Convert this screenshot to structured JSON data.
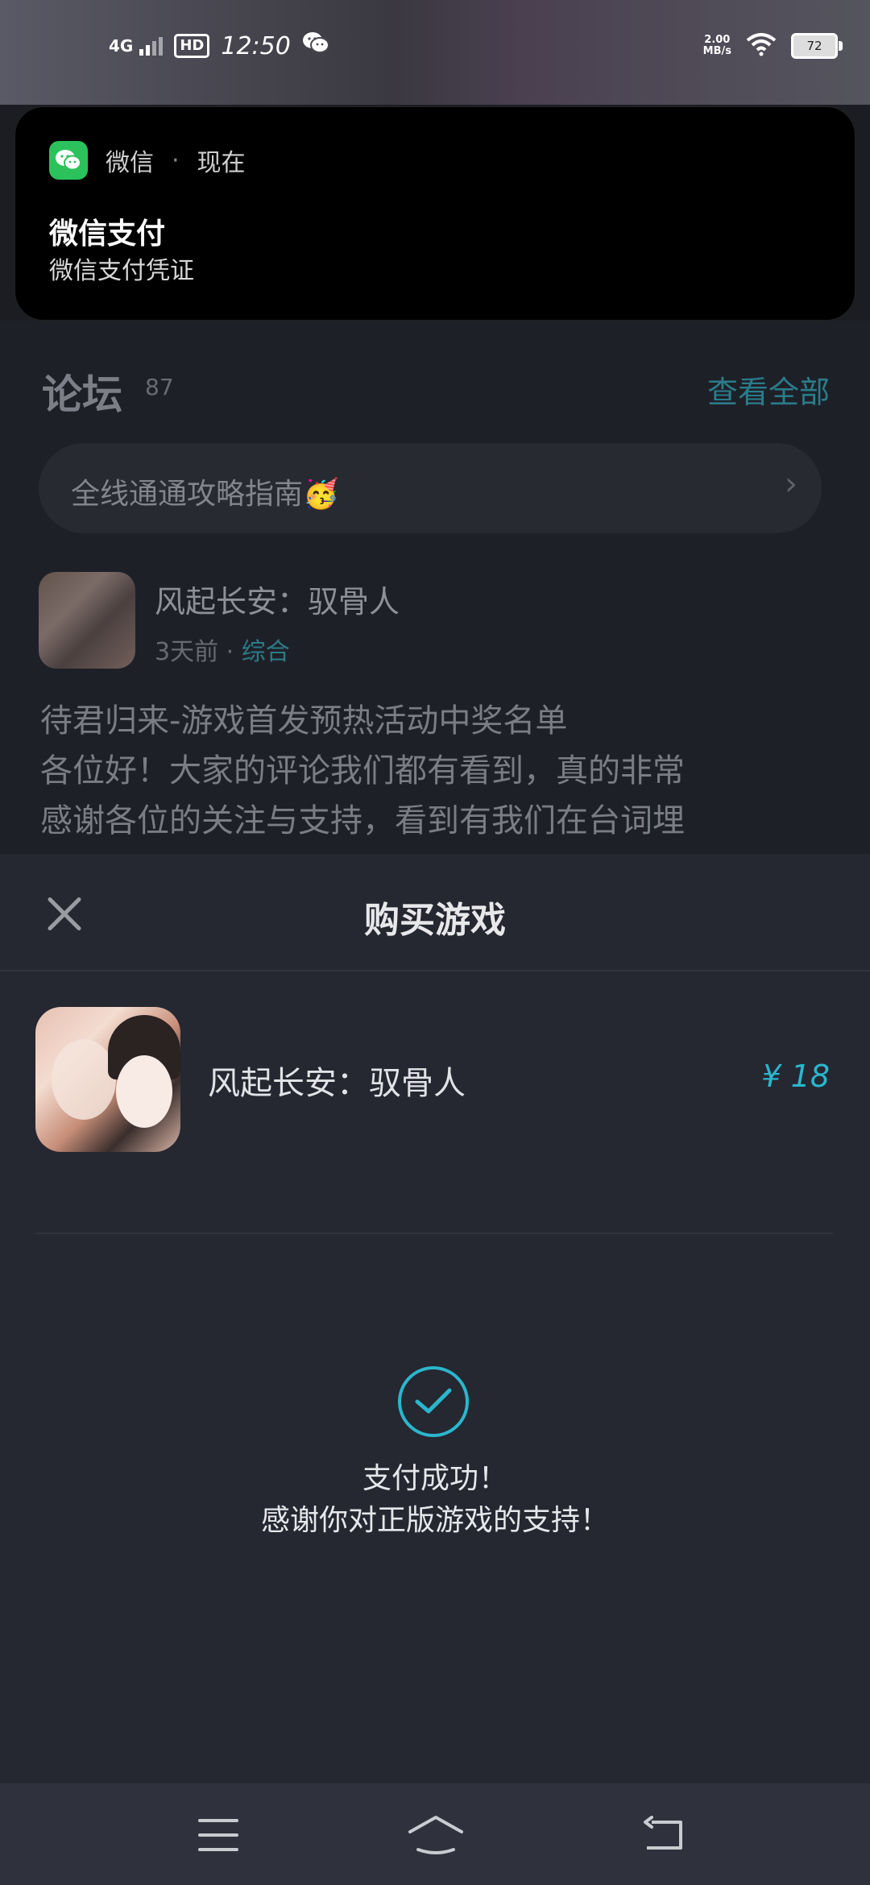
{
  "status_bar": {
    "network": "4G",
    "hd": "HD",
    "time": "12:50",
    "speed_top": "2.00",
    "speed_bottom": "MB/s",
    "battery": "72"
  },
  "notification": {
    "app": "微信",
    "separator": "·",
    "when": "现在",
    "title": "微信支付",
    "body": "微信支付凭证"
  },
  "forum": {
    "title": "论坛",
    "count": "87",
    "view_all": "查看全部",
    "guide": "全线通通攻略指南🥳",
    "post": {
      "game_name": "风起长安：驭骨人",
      "time": "3天前",
      "dot": "·",
      "tag": "综合",
      "line1": "待君归来-游戏首发预热活动中奖名单",
      "line2": "各位好！大家的评论我们都有看到，真的非常",
      "line3": "感谢各位的关注与支持，看到有我们在台词埋"
    }
  },
  "sheet": {
    "title": "购买游戏",
    "game_name": "风起长安：驭骨人",
    "price": "¥ 18",
    "success_line1": "支付成功！",
    "success_line2": "感谢你对正版游戏的支持！"
  },
  "colors": {
    "accent": "#2bb6cc",
    "wechat_green": "#2bc25b",
    "sheet_bg": "#252731"
  },
  "icons": {
    "close": "close-icon",
    "success": "check-circle-icon",
    "menu": "menu-icon",
    "home": "home-icon",
    "back": "back-icon"
  }
}
